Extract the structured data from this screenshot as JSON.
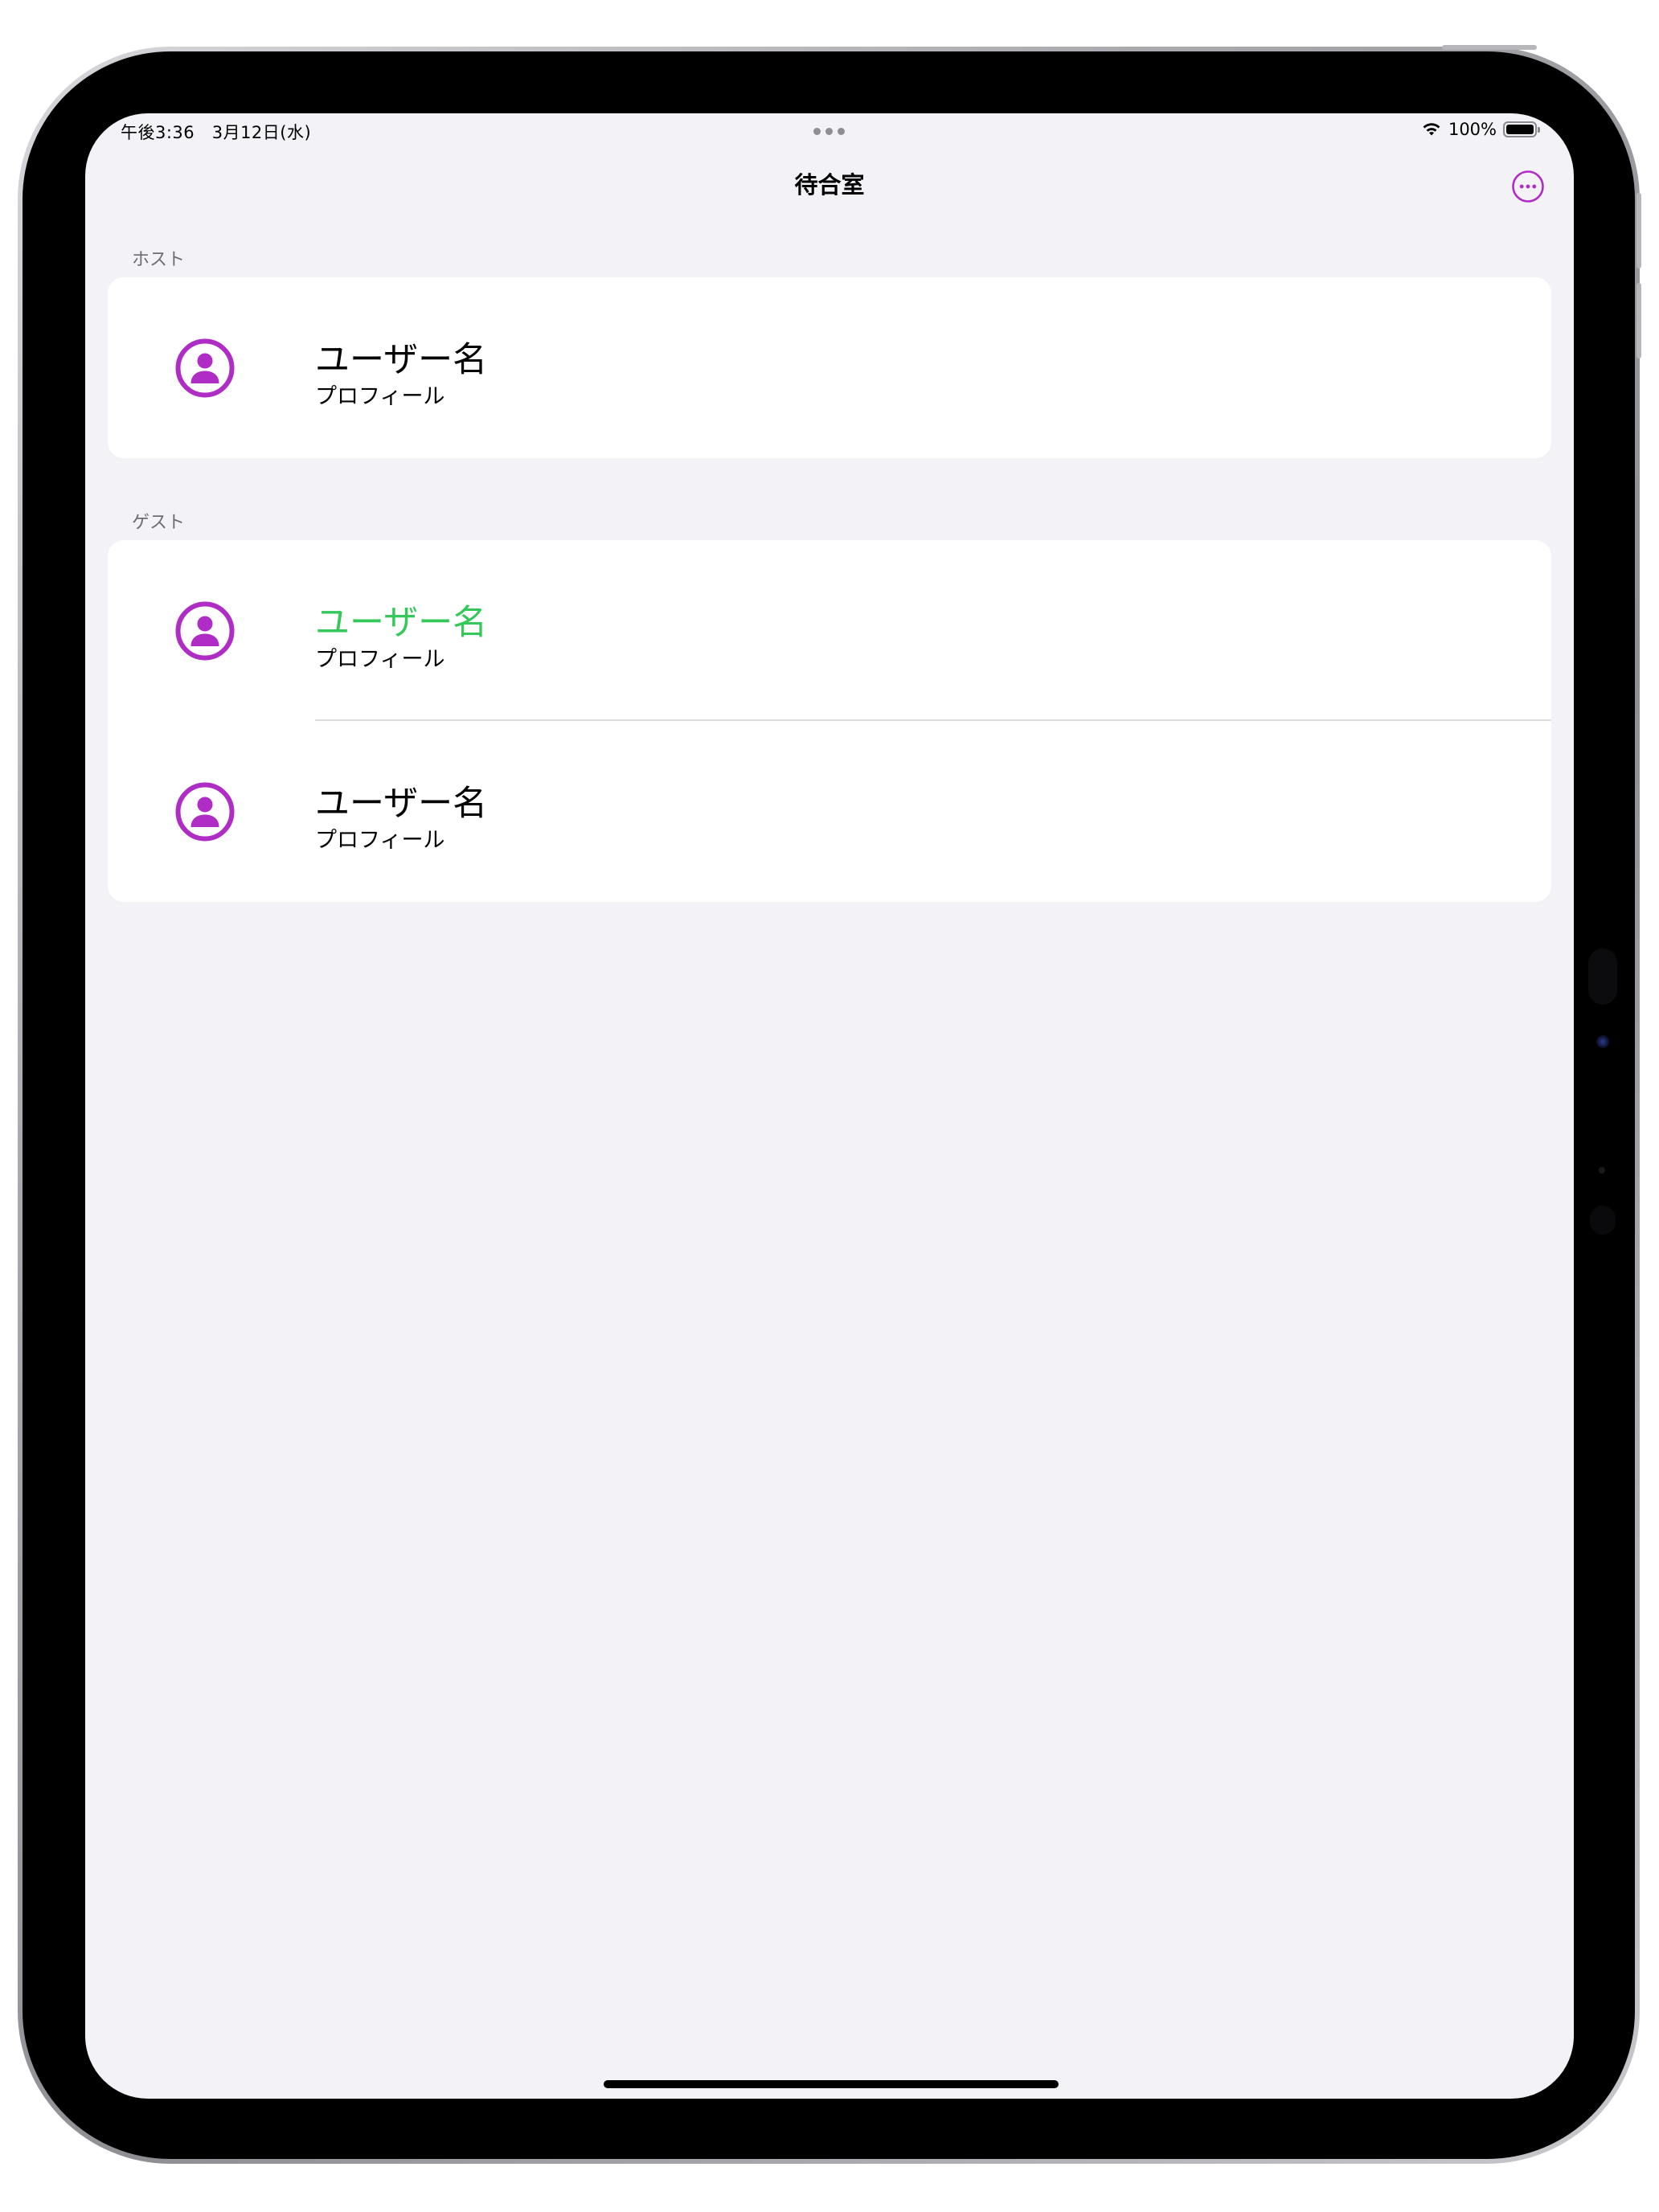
{
  "status_bar": {
    "time": "午後3:36",
    "date": "3月12日(水)",
    "battery": "100%"
  },
  "nav": {
    "title": "待合室",
    "more_icon": "ellipsis-circle-icon"
  },
  "sections": {
    "host": {
      "header": "ホスト",
      "rows": [
        {
          "name": "ユーザー名",
          "profile": "プロフィール",
          "icon": "person-circle-icon"
        }
      ]
    },
    "guest": {
      "header": "ゲスト",
      "rows": [
        {
          "name": "ユーザー名",
          "profile": "プロフィール",
          "icon": "person-circle-icon",
          "highlighted": true
        },
        {
          "name": "ユーザー名",
          "profile": "プロフィール",
          "icon": "person-circle-icon"
        }
      ]
    }
  },
  "colors": {
    "accent": "#af2cc5",
    "highlight_name": "#34c759",
    "background": "#f2f2f7",
    "section_header": "#6d6d72"
  }
}
